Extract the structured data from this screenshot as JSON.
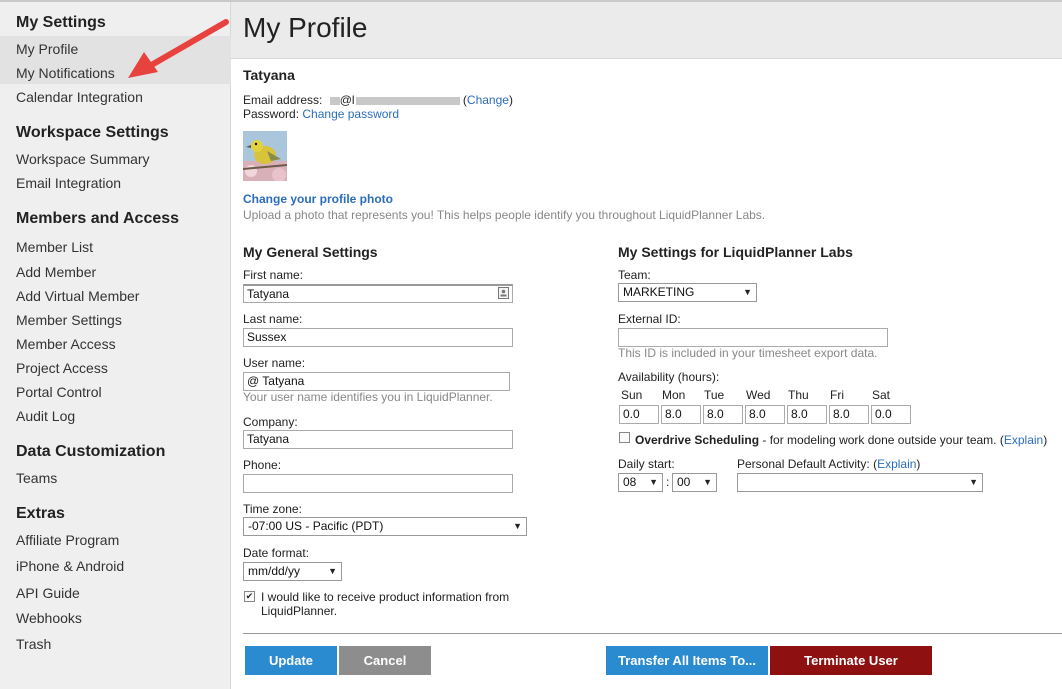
{
  "sidebar": {
    "sections": [
      {
        "title": "My Settings",
        "items": [
          "My Profile",
          "My Notifications",
          "Calendar Integration"
        ]
      },
      {
        "title": "Workspace Settings",
        "items": [
          "Workspace Summary",
          "Email Integration"
        ]
      },
      {
        "title": "Members and Access",
        "items": [
          "Member List",
          "Add Member",
          "Add Virtual Member",
          "Member Settings",
          "Member Access",
          "Project Access",
          "Portal Control",
          "Audit Log"
        ]
      },
      {
        "title": "Data Customization",
        "items": [
          "Teams"
        ]
      },
      {
        "title": "Extras",
        "items": [
          "Affiliate Program",
          "iPhone & Android",
          "API Guide",
          "Webhooks",
          "Trash"
        ]
      }
    ]
  },
  "annotation": {
    "arrow_color": "#e8423f"
  },
  "header": {
    "title": "My Profile"
  },
  "profile": {
    "name": "Tatyana",
    "email_label": "Email address:",
    "email_visible_fragment": "@l",
    "change_open": "(",
    "change_link": "Change",
    "change_close": ")",
    "password_label": "Password:",
    "change_password_link": "Change password",
    "change_photo_link": "Change your profile photo",
    "photo_help": "Upload a photo that represents you! This helps people identify you throughout LiquidPlanner Labs."
  },
  "general": {
    "title": "My General Settings",
    "first_name_label": "First name:",
    "first_name_value": "Tatyana",
    "last_name_label": "Last name:",
    "last_name_value": "Sussex",
    "user_name_label": "User name:",
    "user_name_value": "@ Tatyana",
    "user_name_help": "Your user name identifies you in LiquidPlanner.",
    "company_label": "Company:",
    "company_value": "Tatyana",
    "phone_label": "Phone:",
    "phone_value": "",
    "timezone_label": "Time zone:",
    "timezone_value": "-07:00 US - Pacific (PDT)",
    "date_format_label": "Date format:",
    "date_format_value": "mm/dd/yy",
    "product_info_checked": true,
    "product_info_label_1": "I would like to receive product information from",
    "product_info_label_2": "LiquidPlanner."
  },
  "labs": {
    "title": "My Settings for LiquidPlanner Labs",
    "team_label": "Team:",
    "team_value": "MARKETING",
    "external_id_label": "External ID:",
    "external_id_value": "",
    "external_id_help": "This ID is included in your timesheet export data.",
    "availability_label": "Availability (hours):",
    "days": [
      "Sun",
      "Mon",
      "Tue",
      "Wed",
      "Thu",
      "Fri",
      "Sat"
    ],
    "hours": [
      "0.0",
      "8.0",
      "8.0",
      "8.0",
      "8.0",
      "8.0",
      "0.0"
    ],
    "overdrive_checked": false,
    "overdrive_bold": "Overdrive Scheduling",
    "overdrive_rest": " - for modeling work done outside your team. ",
    "explain_open": "(",
    "explain_link": "Explain",
    "explain_close": ")",
    "daily_start_label": "Daily start:",
    "start_hour": "08",
    "start_colon": ":",
    "start_min": "00",
    "default_activity_label": "Personal Default Activity: ",
    "default_activity_explain": "Explain",
    "default_activity_value": ""
  },
  "buttons": {
    "update": "Update",
    "cancel": "Cancel",
    "transfer": "Transfer All Items To...",
    "terminate": "Terminate User",
    "colors": {
      "blue": "#2b8bd1",
      "gray": "#8d8d8d",
      "red": "#8e1010"
    }
  }
}
